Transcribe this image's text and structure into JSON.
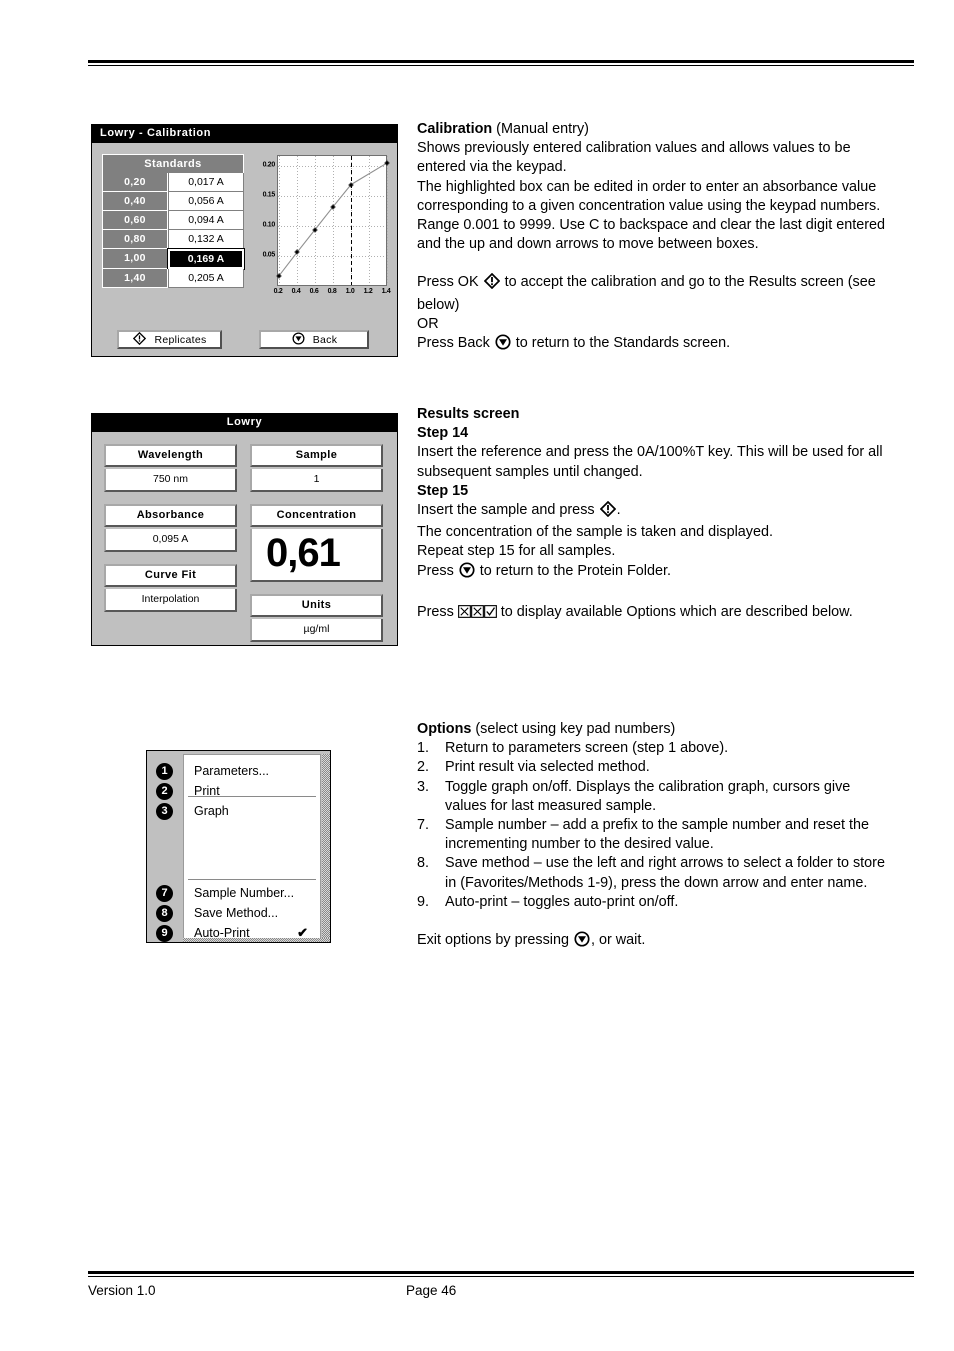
{
  "footer": {
    "version": "Version 1.0",
    "page": "Page 46"
  },
  "screens": {
    "calibration": {
      "title": "Lowry - Calibration",
      "standards_header": "Standards",
      "rows": [
        {
          "concentration": "0,20",
          "absorbance": "0,017 A",
          "selected": false
        },
        {
          "concentration": "0,40",
          "absorbance": "0,056 A",
          "selected": false
        },
        {
          "concentration": "0,60",
          "absorbance": "0,094 A",
          "selected": false
        },
        {
          "concentration": "0,80",
          "absorbance": "0,132 A",
          "selected": false
        },
        {
          "concentration": "1,00",
          "absorbance": "0,169 A",
          "selected": true
        },
        {
          "concentration": "1,40",
          "absorbance": "0,205 A",
          "selected": false
        }
      ],
      "buttons": {
        "replicates": "Replicates",
        "back": "Back"
      }
    },
    "results": {
      "title": "Lowry",
      "fields": {
        "wavelength_label": "Wavelength",
        "wavelength_value": "750 nm",
        "absorbance_label": "Absorbance",
        "absorbance_value": "0,095 A",
        "curve_fit_label": "Curve Fit",
        "curve_fit_value": "Interpolation",
        "sample_label": "Sample",
        "sample_value": "1",
        "concentration_label": "Concentration",
        "concentration_value": "0,61",
        "units_label": "Units",
        "units_value": "µg/ml"
      }
    },
    "options_menu": {
      "items": [
        {
          "number": "1",
          "label": "Parameters...",
          "checked": false
        },
        {
          "number": "2",
          "label": "Print",
          "checked": false
        },
        {
          "number": "3",
          "label": "Graph",
          "checked": false
        },
        {
          "number": "7",
          "label": "Sample Number...",
          "checked": false
        },
        {
          "number": "8",
          "label": "Save Method...",
          "checked": false
        },
        {
          "number": "9",
          "label": "Auto-Print",
          "checked": true
        }
      ],
      "check_mark": "✔"
    }
  },
  "chart_data": {
    "type": "line",
    "title": "",
    "xlabel": "",
    "ylabel": "",
    "x": [
      0.2,
      0.4,
      0.6,
      0.8,
      1.0,
      1.4
    ],
    "y": [
      0.017,
      0.056,
      0.094,
      0.132,
      0.169,
      0.205
    ],
    "xticks": [
      "0.2",
      "0.4",
      "0.6",
      "0.8",
      "1.0",
      "1.2",
      "1.4"
    ],
    "xtick_values": [
      0.2,
      0.4,
      0.6,
      0.8,
      1.0,
      1.2,
      1.4
    ],
    "yticks": [
      "0.05",
      "0.10",
      "0.15",
      "0.20"
    ],
    "ytick_values": [
      0.05,
      0.1,
      0.15,
      0.2
    ],
    "xlim": [
      0.2,
      1.4
    ],
    "ylim": [
      0.0,
      0.215
    ],
    "grid": true,
    "legend": "none",
    "cursor_x": 1.0,
    "marker": "plus"
  },
  "prose": {
    "calibration": {
      "heading_bold": "Calibration",
      "heading_rest": " (Manual entry)",
      "p1": "Shows previously entered calibration values and allows values to be entered via the keypad.",
      "p2": "The highlighted box can be edited in order to enter an absorbance value corresponding to a given concentration value using the keypad numbers. Range 0.001 to 9999. Use C to backspace and clear the last digit entered and the up and down arrows to move between boxes.",
      "press_ok_pre": "Press OK ",
      "press_ok_post": " to accept the calibration and go to the Results screen (see below)",
      "or": "OR",
      "press_back_pre": "Press Back ",
      "press_back_post": " to return to the Standards screen."
    },
    "results": {
      "heading": "Results screen",
      "step14_label": "Step 14",
      "step14_text": "Insert the reference and press the 0A/100%T key. This will be used for all subsequent samples until changed.",
      "step15_label": "Step 15",
      "step15_pre": "Insert the sample and press ",
      "step15_post": ".",
      "line1": "The concentration of the sample is taken and displayed.",
      "line2": "Repeat step 15 for all samples.",
      "press_back_pre": "Press ",
      "press_back_post": " to return to the Protein Folder.",
      "press_options_pre": "Press ",
      "press_options_post": " to display available Options which are described below."
    },
    "options": {
      "heading_bold": "Options",
      "heading_rest": " (select using key pad numbers)",
      "items": [
        {
          "num": "1.",
          "text": "Return to parameters screen (step 1 above)."
        },
        {
          "num": "2.",
          "text": "Print result via selected method."
        },
        {
          "num": "3.",
          "text": "Toggle graph on/off. Displays the calibration graph, cursors give values for last measured sample."
        },
        {
          "num": "7.",
          "text": "Sample number – add a prefix to the sample number and reset the incrementing number to the desired value."
        },
        {
          "num": "8.",
          "text": "Save method – use the left and right arrows to select a folder to store in (Favorites/Methods 1-9), press the down arrow and enter name."
        },
        {
          "num": "9.",
          "text": "Auto-print – toggles auto-print on/off."
        }
      ],
      "exit_pre": "Exit options by pressing ",
      "exit_post": ", or wait."
    }
  },
  "colors": {
    "lcd_background": "#c0c0c0",
    "lcd_titlebar": "#000000",
    "lcd_titlebar_text": "#ffffff",
    "table_header": "#808080",
    "field_background": "#ffffff",
    "selected_background": "#000000",
    "page_background": "#ffffff"
  }
}
